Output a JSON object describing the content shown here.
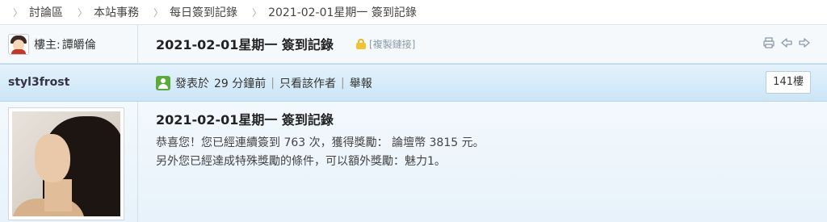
{
  "breadcrumb": {
    "items": [
      "討論區",
      "本站事務",
      "每日簽到記錄",
      "2021-02-01星期一 簽到記錄"
    ]
  },
  "header": {
    "owner_label": "樓主:",
    "owner_name": "譚皭倫",
    "title": "2021-02-01星期一 簽到記錄",
    "copy_link": "[複製鏈接]",
    "tool_icons": [
      "print-icon",
      "arrow-left-icon",
      "arrow-right-icon"
    ]
  },
  "post": {
    "username": "styl3frost",
    "posted_label": "發表於",
    "posted_time": "29 分鐘前",
    "only_author": "只看該作者",
    "report": "舉報",
    "floor": "141樓",
    "message_title": "2021-02-01星期一 簽到記錄",
    "line1": "恭喜您！您已經連續簽到 763 次，獲得獎勵： 論壇幣 3815 元。",
    "line2": "另外您已經達成特殊獎勵的條件，可以額外獎勵：魅力1。"
  },
  "colors": {
    "bar_top": "#e4f2fb",
    "bar_bottom": "#cbe5f6",
    "online_icon": "#5aaa3c"
  }
}
